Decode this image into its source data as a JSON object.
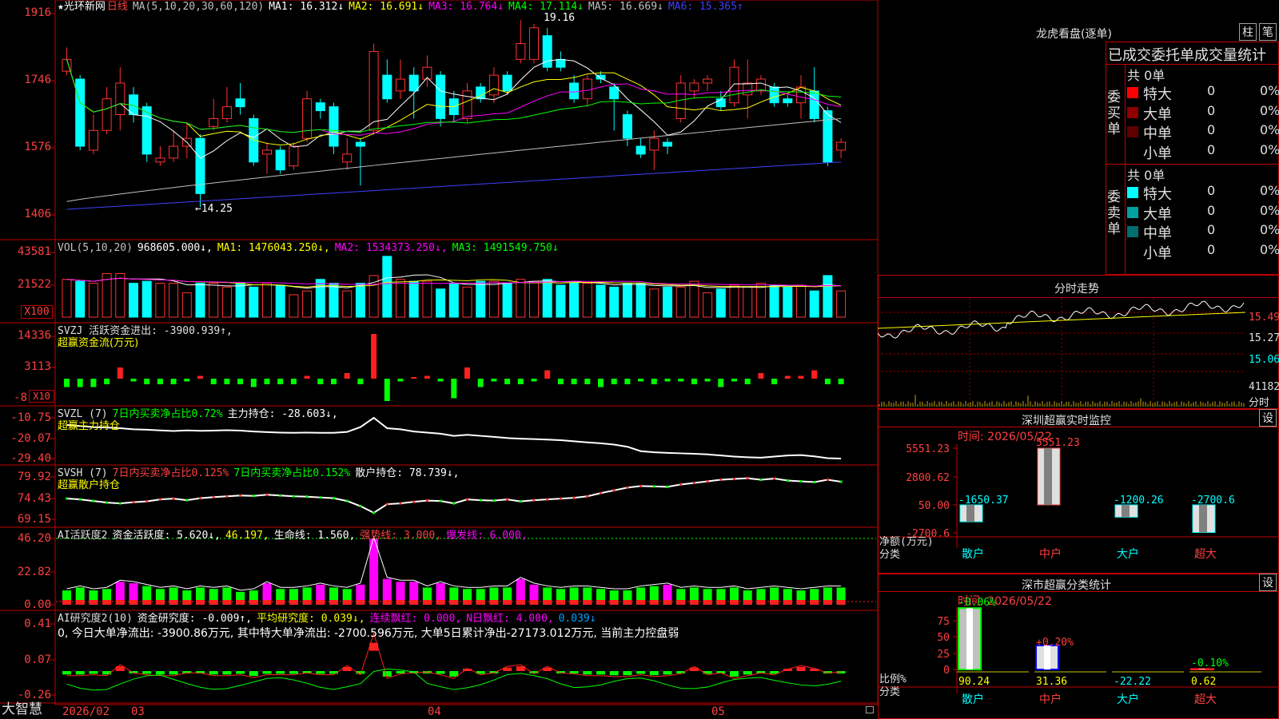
{
  "app": {
    "brand": "大智慧"
  },
  "header": {
    "star": "★",
    "stock_name": "光环新网",
    "period": "日线",
    "ma_label": "MA(5,10,20,30,60,120)",
    "ma": [
      {
        "label": "MA1: 16.312↓",
        "color": "#ffffff"
      },
      {
        "label": "MA2: 16.691↓",
        "color": "#ffff00"
      },
      {
        "label": "MA3: 16.764↓",
        "color": "#ff00ff"
      },
      {
        "label": "MA4: 17.114↓",
        "color": "#00ff00"
      },
      {
        "label": "MA5: 16.669↓",
        "color": "#c0c0c0"
      },
      {
        "label": "MA6: 15.365↑",
        "color": "#4040ff"
      }
    ]
  },
  "price_axis": [
    "1916",
    "1746",
    "1576",
    "1406"
  ],
  "price_annot": {
    "high": "19.16",
    "low": "←14.25"
  },
  "vol": {
    "label": "VOL(5,10,20)",
    "value": "968605.000↓,",
    "ma1": "MA1: 1476043.250↓,",
    "ma2": "MA2: 1534373.250↓,",
    "ma3": "MA3: 1491549.750↓",
    "axis": [
      "43581",
      "21522",
      "X100"
    ]
  },
  "svzj": {
    "label": "SVZJ  活跃资金进出: -3900.939↑,",
    "sub": "超赢资金流(万元)",
    "axis": [
      "14336",
      "3113",
      "-8",
      "X10"
    ]
  },
  "svzl": {
    "label": "SVZL (7)",
    "p1": "7日内买卖净占比0.72%",
    "p2": "主力持仓: -28.603↓,",
    "sub": "超赢主力持仓",
    "axis": [
      "-10.75",
      "-20.07",
      "-29.40"
    ]
  },
  "svsh": {
    "label": "SVSH (7)",
    "p1": "7日内买卖净占比0.125%",
    "p2": "7日内买卖净占比0.152%",
    "p3": "散户持仓: 78.739↓,",
    "sub": "超赢散户持仓",
    "axis": [
      "79.92",
      "74.43",
      "69.15"
    ]
  },
  "ai1": {
    "label": "AI活跃度2",
    "p1": "资金活跃度: 5.620↓,",
    "p2": "46.197,",
    "p3": "生命线: 1.560,",
    "p4": "强势线: 3.000,",
    "p5": "爆发线: 6.000,",
    "axis": [
      "46.20",
      "22.82",
      "0.00"
    ]
  },
  "ai2": {
    "label": "AI研究度2(10)",
    "p1": "资金研究度: -0.009↑,",
    "p2": "平均研究度: 0.039↓,",
    "p3": "连续飘红: 0.000,",
    "p4": "N日飘红: 4.000,",
    "p5": "0.039↓",
    "msg": "0, 今日大单净流出: -3900.86万元, 其中特大单净流出: -2700.596万元, 大单5日累计净出-27173.012万元, 当前主力控盘弱",
    "axis": [
      "0.41",
      "0.07",
      "-0.26"
    ]
  },
  "date_axis": [
    "2026/02",
    "03",
    "04",
    "05"
  ],
  "dragon": {
    "title": "龙虎看盘(逐单)",
    "btn1": "柱",
    "btn2": "笔",
    "tabs": "已成交委托单成交量统计",
    "buy": {
      "side": "委买单",
      "total": "共 0单",
      "rows": [
        {
          "name": "特大",
          "v": "0",
          "p": "0%",
          "color": "#ff0000"
        },
        {
          "name": "大单",
          "v": "0",
          "p": "0%",
          "color": "#900000"
        },
        {
          "name": "中单",
          "v": "0",
          "p": "0%",
          "color": "#600000"
        },
        {
          "name": "小单",
          "v": "0",
          "p": "0%",
          "color": "#000000"
        }
      ]
    },
    "sell": {
      "side": "委卖单",
      "total": "共 0单",
      "rows": [
        {
          "name": "特大",
          "v": "0",
          "p": "0%",
          "color": "#00ffff"
        },
        {
          "name": "大单",
          "v": "0",
          "p": "0%",
          "color": "#00a0a0"
        },
        {
          "name": "中单",
          "v": "0",
          "p": "0%",
          "color": "#006e6e"
        },
        {
          "name": "小单",
          "v": "0",
          "p": "0%",
          "color": "#000000"
        }
      ]
    }
  },
  "intraday": {
    "title": "分时走势",
    "axis": [
      "15.49",
      "15.27",
      "15.06",
      "41182",
      "分时"
    ]
  },
  "monitor": {
    "title": "深圳超赢实时监控",
    "btn": "设",
    "time": "时间: 2026/05/22",
    "axis": [
      "5551.23",
      "2800.62",
      "50.00",
      "-2700.6"
    ],
    "ylabel": "净额(万元)",
    "xlabel": "分类",
    "cats": [
      "散户",
      "中户",
      "大户",
      "超大"
    ],
    "values": [
      -1650.37,
      5551.23,
      -1200.26,
      -2700.6
    ],
    "labels": [
      "-1650.37",
      "5551.23",
      "-1200.26",
      "-2700.6"
    ]
  },
  "classify": {
    "title": "深市超赢分类统计",
    "btn": "设",
    "time": "时间: 2026/05/22",
    "axis": [
      "75",
      "50",
      "25",
      "0"
    ],
    "ylabel": "比例%",
    "xlabel": "分类",
    "cats": [
      "散户",
      "中户",
      "大户",
      "超大"
    ],
    "top": [
      "-0.06%",
      "+0.20%",
      "",
      "-0.10%"
    ],
    "values": [
      90.24,
      31.36,
      -22.22,
      0.62
    ],
    "labels": [
      "90.24",
      "31.36",
      "-22.22",
      "0.62"
    ]
  },
  "chart_data": {
    "type": "candlestick",
    "title": "光环新网 日线",
    "ylim": [
      1406,
      1916
    ],
    "candles": [
      {
        "o": 1770,
        "c": 1800,
        "h": 1830,
        "l": 1760
      },
      {
        "o": 1750,
        "c": 1580,
        "h": 1760,
        "l": 1570
      },
      {
        "o": 1570,
        "c": 1620,
        "h": 1660,
        "l": 1560
      },
      {
        "o": 1620,
        "c": 1700,
        "h": 1730,
        "l": 1610
      },
      {
        "o": 1660,
        "c": 1740,
        "h": 1780,
        "l": 1620
      },
      {
        "o": 1710,
        "c": 1660,
        "h": 1730,
        "l": 1640
      },
      {
        "o": 1680,
        "c": 1560,
        "h": 1690,
        "l": 1540
      },
      {
        "o": 1540,
        "c": 1550,
        "h": 1580,
        "l": 1530
      },
      {
        "o": 1550,
        "c": 1580,
        "h": 1620,
        "l": 1540
      },
      {
        "o": 1580,
        "c": 1600,
        "h": 1640,
        "l": 1550
      },
      {
        "o": 1600,
        "c": 1460,
        "h": 1610,
        "l": 1425
      },
      {
        "o": 1630,
        "c": 1650,
        "h": 1700,
        "l": 1620
      },
      {
        "o": 1650,
        "c": 1680,
        "h": 1730,
        "l": 1640
      },
      {
        "o": 1700,
        "c": 1680,
        "h": 1740,
        "l": 1660
      },
      {
        "o": 1650,
        "c": 1540,
        "h": 1660,
        "l": 1530
      },
      {
        "o": 1560,
        "c": 1570,
        "h": 1590,
        "l": 1510
      },
      {
        "o": 1570,
        "c": 1520,
        "h": 1580,
        "l": 1510
      },
      {
        "o": 1530,
        "c": 1580,
        "h": 1590,
        "l": 1520
      },
      {
        "o": 1600,
        "c": 1700,
        "h": 1720,
        "l": 1590
      },
      {
        "o": 1690,
        "c": 1670,
        "h": 1700,
        "l": 1650
      },
      {
        "o": 1680,
        "c": 1580,
        "h": 1690,
        "l": 1560
      },
      {
        "o": 1540,
        "c": 1560,
        "h": 1600,
        "l": 1520
      },
      {
        "o": 1590,
        "c": 1580,
        "h": 1600,
        "l": 1480
      },
      {
        "o": 1620,
        "c": 1820,
        "h": 1840,
        "l": 1610
      },
      {
        "o": 1760,
        "c": 1700,
        "h": 1800,
        "l": 1690
      },
      {
        "o": 1720,
        "c": 1750,
        "h": 1800,
        "l": 1700
      },
      {
        "o": 1760,
        "c": 1720,
        "h": 1780,
        "l": 1650
      },
      {
        "o": 1750,
        "c": 1780,
        "h": 1810,
        "l": 1730
      },
      {
        "o": 1760,
        "c": 1650,
        "h": 1770,
        "l": 1630
      },
      {
        "o": 1700,
        "c": 1660,
        "h": 1720,
        "l": 1640
      },
      {
        "o": 1650,
        "c": 1720,
        "h": 1740,
        "l": 1640
      },
      {
        "o": 1730,
        "c": 1700,
        "h": 1740,
        "l": 1690
      },
      {
        "o": 1710,
        "c": 1760,
        "h": 1780,
        "l": 1690
      },
      {
        "o": 1760,
        "c": 1720,
        "h": 1770,
        "l": 1710
      },
      {
        "o": 1800,
        "c": 1840,
        "h": 1900,
        "l": 1790
      },
      {
        "o": 1800,
        "c": 1880,
        "h": 1890,
        "l": 1790
      },
      {
        "o": 1860,
        "c": 1780,
        "h": 1880,
        "l": 1770
      },
      {
        "o": 1800,
        "c": 1780,
        "h": 1820,
        "l": 1770
      },
      {
        "o": 1740,
        "c": 1700,
        "h": 1760,
        "l": 1690
      },
      {
        "o": 1700,
        "c": 1750,
        "h": 1760,
        "l": 1680
      },
      {
        "o": 1760,
        "c": 1750,
        "h": 1770,
        "l": 1740
      },
      {
        "o": 1730,
        "c": 1700,
        "h": 1740,
        "l": 1620
      },
      {
        "o": 1660,
        "c": 1600,
        "h": 1670,
        "l": 1580
      },
      {
        "o": 1580,
        "c": 1560,
        "h": 1600,
        "l": 1550
      },
      {
        "o": 1570,
        "c": 1600,
        "h": 1620,
        "l": 1520
      },
      {
        "o": 1590,
        "c": 1580,
        "h": 1600,
        "l": 1560
      },
      {
        "o": 1650,
        "c": 1740,
        "h": 1760,
        "l": 1640
      },
      {
        "o": 1720,
        "c": 1740,
        "h": 1750,
        "l": 1700
      },
      {
        "o": 1740,
        "c": 1750,
        "h": 1760,
        "l": 1720
      },
      {
        "o": 1700,
        "c": 1680,
        "h": 1720,
        "l": 1670
      },
      {
        "o": 1690,
        "c": 1780,
        "h": 1800,
        "l": 1680
      },
      {
        "o": 1710,
        "c": 1740,
        "h": 1800,
        "l": 1650
      },
      {
        "o": 1720,
        "c": 1750,
        "h": 1760,
        "l": 1710
      },
      {
        "o": 1730,
        "c": 1690,
        "h": 1740,
        "l": 1680
      },
      {
        "o": 1700,
        "c": 1690,
        "h": 1710,
        "l": 1680
      },
      {
        "o": 1690,
        "c": 1730,
        "h": 1760,
        "l": 1650
      },
      {
        "o": 1720,
        "c": 1650,
        "h": 1780,
        "l": 1640
      },
      {
        "o": 1670,
        "c": 1540,
        "h": 1680,
        "l": 1530
      },
      {
        "o": 1570,
        "c": 1590,
        "h": 1600,
        "l": 1550
      }
    ],
    "volume": [
      18,
      17,
      16,
      21,
      21,
      16,
      17,
      16,
      16,
      11,
      16,
      16,
      14,
      16,
      14,
      16,
      15,
      10,
      12,
      18,
      16,
      12,
      16,
      20,
      30,
      18,
      17,
      17,
      13,
      16,
      14,
      17,
      17,
      16,
      18,
      17,
      18,
      15,
      16,
      16,
      15,
      14,
      16,
      16,
      13,
      14,
      14,
      17,
      11,
      13,
      15,
      14,
      16,
      15,
      14,
      15,
      12,
      20,
      12
    ],
    "svzj": [
      -3,
      -3,
      -3,
      -2,
      4,
      -1,
      -2,
      -2,
      -2,
      -1,
      1,
      -2,
      -2,
      -2,
      -3,
      -2,
      -2,
      -2,
      1,
      -2,
      -2,
      2,
      -2,
      16,
      -8,
      -1,
      0,
      1,
      -1,
      -7,
      4,
      -3,
      -1,
      -2,
      -2,
      -1,
      3,
      -2,
      -2,
      -2,
      -3,
      -2,
      -2,
      -1,
      -2,
      -1,
      -1,
      -2,
      -1,
      -3,
      -1,
      -2,
      2,
      -2,
      1,
      1,
      3,
      -2,
      -2
    ],
    "ai1": [
      10,
      12,
      10,
      11,
      16,
      15,
      13,
      11,
      12,
      10,
      12,
      11,
      12,
      9,
      10,
      15,
      11,
      11,
      12,
      14,
      12,
      11,
      14,
      46,
      18,
      16,
      16,
      12,
      15,
      12,
      11,
      11,
      12,
      12,
      18,
      14,
      12,
      11,
      12,
      12,
      11,
      10,
      10,
      12,
      13,
      14,
      11,
      12,
      11,
      11,
      12,
      10,
      11,
      12,
      11,
      10,
      11,
      12,
      12
    ],
    "ai2": [
      -0.05,
      -0.05,
      -0.04,
      -0.05,
      0.07,
      -0.02,
      -0.04,
      -0.05,
      -0.05,
      -0.02,
      -0.02,
      -0.05,
      -0.05,
      -0.04,
      -0.07,
      -0.04,
      -0.04,
      -0.04,
      -0.02,
      -0.04,
      -0.04,
      0.06,
      -0.04,
      0.41,
      -0.08,
      -0.03,
      -0.02,
      -0.01,
      -0.04,
      -0.08,
      0.03,
      -0.04,
      -0.02,
      0.05,
      0.07,
      -0.03,
      0.05,
      -0.02,
      -0.03,
      -0.05,
      -0.05,
      -0.06,
      -0.06,
      -0.04,
      -0.06,
      -0.05,
      -0.03,
      0.05,
      -0.04,
      -0.02,
      -0.08,
      -0.05,
      -0.02,
      -0.04,
      0.02,
      0.06,
      0.03,
      -0.02,
      -0.01
    ],
    "svzl": [
      -14,
      -14.5,
      -15,
      -15.2,
      -15.5,
      -16,
      -16.2,
      -16.5,
      -16.8,
      -16.5,
      -16.7,
      -16.6,
      -16.4,
      -16.6,
      -17,
      -17.3,
      -17.5,
      -17.6,
      -17.5,
      -17.6,
      -17.6,
      -17.2,
      -15,
      -10.75,
      -15.5,
      -16,
      -17,
      -17.5,
      -18,
      -19,
      -18.5,
      -19,
      -19.5,
      -20,
      -20.3,
      -20.5,
      -20.7,
      -21,
      -21.5,
      -22,
      -22.4,
      -23,
      -24,
      -26,
      -26.5,
      -26.8,
      -27,
      -27.2,
      -27.5,
      -28,
      -28.5,
      -28.8,
      -29,
      -28.5,
      -28,
      -27.8,
      -28.4,
      -29.2,
      -29.4
    ],
    "svsh": [
      74.43,
      74.2,
      73.8,
      73.4,
      73.2,
      73.5,
      73.7,
      74.2,
      74.4,
      74.0,
      74.5,
      74.8,
      75.0,
      75.2,
      75.1,
      75.4,
      75.2,
      75.0,
      74.9,
      74.7,
      74.5,
      73.8,
      72.5,
      70.8,
      73.0,
      73.2,
      73.6,
      73.9,
      73.8,
      73.2,
      74.2,
      74.0,
      73.9,
      74.2,
      73.7,
      74.0,
      74.2,
      74.4,
      74.6,
      75.0,
      75.8,
      76.5,
      77.2,
      77.6,
      77.5,
      77.4,
      78.0,
      78.4,
      78.8,
      79.2,
      79.4,
      79.6,
      79.2,
      79.5,
      79.0,
      78.8,
      78.6,
      79.2,
      78.7
    ]
  }
}
